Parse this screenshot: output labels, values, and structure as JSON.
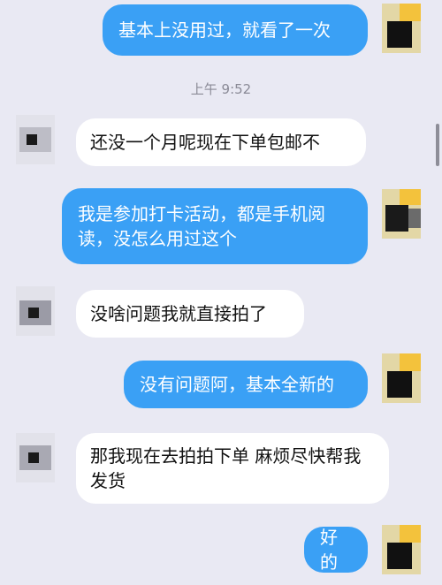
{
  "chat": {
    "timestamp": "上午 9:52",
    "messages": [
      {
        "side": "out",
        "text": "基本上没用过，就看了一次"
      },
      {
        "side": "in",
        "text": "还没一个月呢现在下单包邮不"
      },
      {
        "side": "out",
        "text": "我是参加打卡活动，都是手机阅读，没怎么用过这个"
      },
      {
        "side": "in",
        "text": "没啥问题我就直接拍了"
      },
      {
        "side": "out",
        "text": "没有问题阿，基本全新的"
      },
      {
        "side": "in",
        "text": "那我现在去拍拍下单 麻烦尽快帮我发货"
      },
      {
        "side": "out",
        "text": "好的"
      }
    ]
  },
  "avatars": {
    "self_colors": [
      "#f3c23c",
      "#111111",
      "#e3d7a6"
    ],
    "other_colors": [
      "#bdbdc6",
      "#1a1a1a",
      "#ffffff",
      "#8c7a73"
    ]
  }
}
